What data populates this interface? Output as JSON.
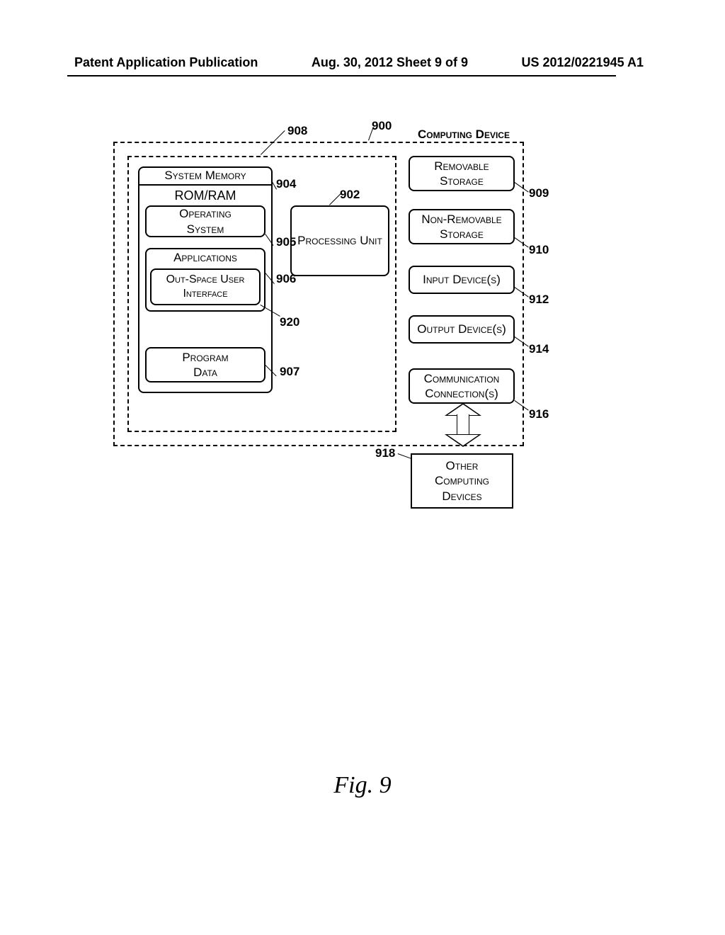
{
  "header": {
    "left": "Patent Application Publication",
    "center": "Aug. 30, 2012  Sheet 9 of 9",
    "right": "US 2012/0221945 A1"
  },
  "figure_label": "Fig. 9",
  "boxes": {
    "system_memory": "System Memory",
    "rom_ram": "ROM/RAM",
    "operating_system": "Operating\nSystem",
    "applications": "Applications",
    "out_space_ui": "Out-Space User\nInterface",
    "program_data": "Program\nData",
    "processing_unit": "Processing Unit",
    "computing_device": "Computing Device",
    "removable_storage": "Removable\nStorage",
    "non_removable_storage": "Non-Removable\nStorage",
    "input_devices": "Input Device(s)",
    "output_devices": "Output Device(s)",
    "communication_connections": "Communication\nConnection(s)",
    "other_computing_devices": "Other\nComputing\nDevices"
  },
  "refs": {
    "r900": "900",
    "r902": "902",
    "r904": "904",
    "r905": "905",
    "r906": "906",
    "r907": "907",
    "r908": "908",
    "r909": "909",
    "r910": "910",
    "r912": "912",
    "r914": "914",
    "r916": "916",
    "r918": "918",
    "r920": "920"
  }
}
